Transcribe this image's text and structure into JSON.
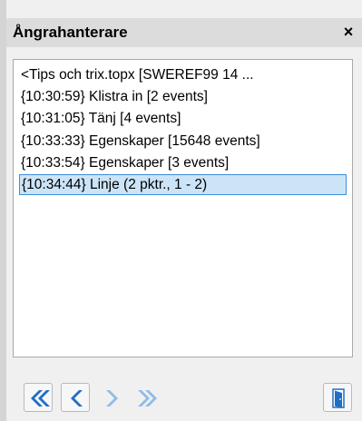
{
  "panel": {
    "title": "Ångrahanterare",
    "close_label": "×"
  },
  "history": {
    "items": [
      {
        "label": "<Tips och trix.topx [SWEREF99 14 ...",
        "selected": false
      },
      {
        "label": "{10:30:59} Klistra in [2 events]",
        "selected": false
      },
      {
        "label": "{10:31:05} Tänj [4 events]",
        "selected": false
      },
      {
        "label": "{10:33:33} Egenskaper [15648 events]",
        "selected": false
      },
      {
        "label": "{10:33:54} Egenskaper [3 events]",
        "selected": false
      },
      {
        "label": "{10:34:44} Linje (2 pktr., 1 - 2)",
        "selected": true
      }
    ]
  },
  "toolbar": {
    "buttons": [
      {
        "icon": "double-chevron-left-icon",
        "enabled": true
      },
      {
        "icon": "chevron-left-icon",
        "enabled": true
      },
      {
        "icon": "chevron-right-icon",
        "enabled": false
      },
      {
        "icon": "double-chevron-right-icon",
        "enabled": false
      },
      {
        "icon": "door-exit-icon",
        "enabled": true
      }
    ]
  },
  "colors": {
    "selection_bg": "#cce4f7",
    "selection_border": "#3c8fd8",
    "icon_active": "#1f6fc5",
    "icon_disabled": "#8fbce6"
  }
}
